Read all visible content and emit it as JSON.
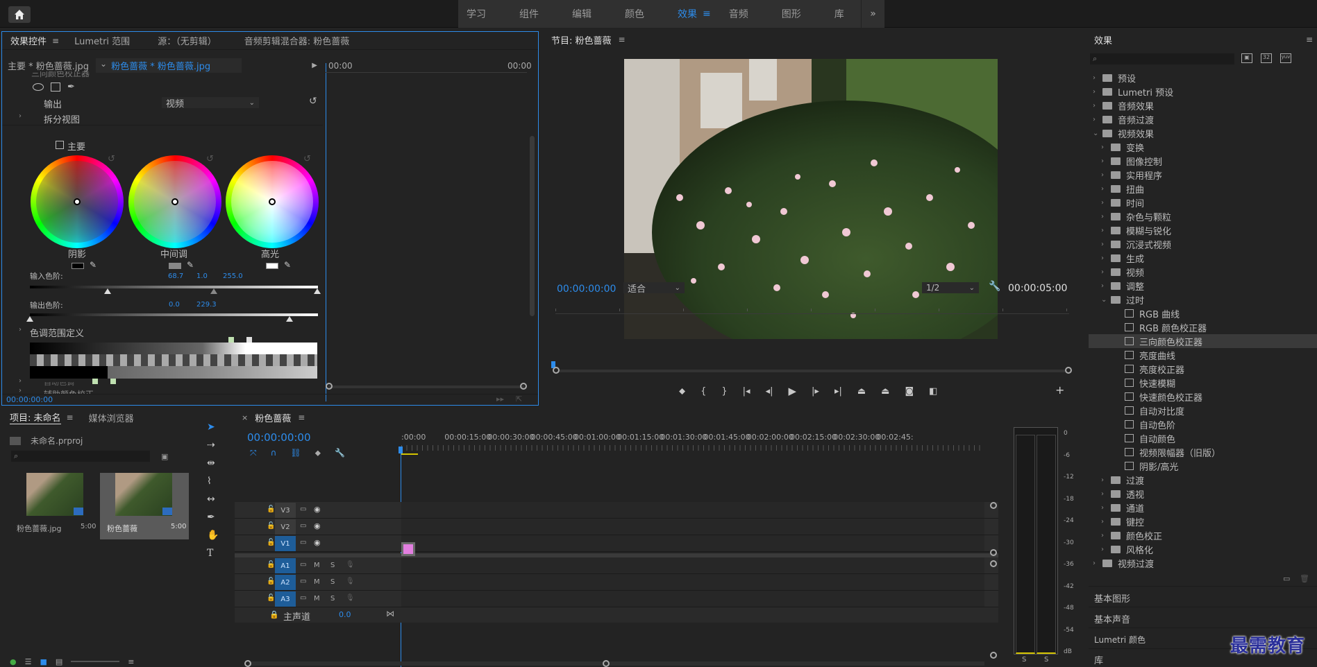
{
  "workspaces": {
    "items": [
      "学习",
      "组件",
      "编辑",
      "颜色",
      "效果",
      "音频",
      "图形",
      "库"
    ],
    "active": "效果",
    "more": "»"
  },
  "effect_controls": {
    "tabs": [
      "效果控件",
      "Lumetri 范围",
      "源：（无剪辑）",
      "音频剪辑混合器: 粉色蔷薇"
    ],
    "master_clip": "主要 * 粉色蔷薇.jpg",
    "sequence_clip": "粉色蔷薇 * 粉色蔷薇.jpg",
    "tc_start": "00:00",
    "tc_end": "00:00",
    "effect_name_partial": "三向颜色校正器",
    "output_label": "输出",
    "output_value": "视频",
    "split_view_label": "拆分视图",
    "master_checkbox": "主要",
    "wheel_labels": [
      "阴影",
      "中间调",
      "高光"
    ],
    "input_levels_label": "输入色阶:",
    "input_levels_values": [
      "68.7",
      "1.0",
      "255.0"
    ],
    "output_levels_label": "输出色阶:",
    "output_levels_values": [
      "0.0",
      "229.3"
    ],
    "tonal_range_label": "色调范围定义",
    "partial_row_1": "自动色调",
    "partial_row_2": "辅助颜色校正",
    "timecode": "00:00:00:00"
  },
  "program": {
    "title": "节目: 粉色蔷薇",
    "timecode": "00:00:00:00",
    "fit": "适合",
    "resolution": "1/2",
    "duration": "00:00:05:00",
    "playhead_fraction": 0.0
  },
  "effects_panel": {
    "title": "效果",
    "items": [
      {
        "label": "预设",
        "level": 0,
        "type": "folder",
        "open": false
      },
      {
        "label": "Lumetri 预设",
        "level": 0,
        "type": "folder",
        "open": false
      },
      {
        "label": "音频效果",
        "level": 0,
        "type": "folder",
        "open": false
      },
      {
        "label": "音频过渡",
        "level": 0,
        "type": "folder",
        "open": false
      },
      {
        "label": "视频效果",
        "level": 0,
        "type": "folder",
        "open": true
      },
      {
        "label": "变换",
        "level": 1,
        "type": "folder",
        "open": false
      },
      {
        "label": "图像控制",
        "level": 1,
        "type": "folder",
        "open": false
      },
      {
        "label": "实用程序",
        "level": 1,
        "type": "folder",
        "open": false
      },
      {
        "label": "扭曲",
        "level": 1,
        "type": "folder",
        "open": false
      },
      {
        "label": "时间",
        "level": 1,
        "type": "folder",
        "open": false
      },
      {
        "label": "杂色与颗粒",
        "level": 1,
        "type": "folder",
        "open": false
      },
      {
        "label": "模糊与锐化",
        "level": 1,
        "type": "folder",
        "open": false
      },
      {
        "label": "沉浸式视频",
        "level": 1,
        "type": "folder",
        "open": false
      },
      {
        "label": "生成",
        "level": 1,
        "type": "folder",
        "open": false
      },
      {
        "label": "视频",
        "level": 1,
        "type": "folder",
        "open": false
      },
      {
        "label": "调整",
        "level": 1,
        "type": "folder",
        "open": false
      },
      {
        "label": "过时",
        "level": 1,
        "type": "folder",
        "open": true
      },
      {
        "label": "RGB 曲线",
        "level": 2,
        "type": "effect"
      },
      {
        "label": "RGB 颜色校正器",
        "level": 2,
        "type": "effect"
      },
      {
        "label": "三向颜色校正器",
        "level": 2,
        "type": "effect",
        "selected": true
      },
      {
        "label": "亮度曲线",
        "level": 2,
        "type": "effect"
      },
      {
        "label": "亮度校正器",
        "level": 2,
        "type": "effect"
      },
      {
        "label": "快速模糊",
        "level": 2,
        "type": "effect"
      },
      {
        "label": "快速颜色校正器",
        "level": 2,
        "type": "effect"
      },
      {
        "label": "自动对比度",
        "level": 2,
        "type": "effect"
      },
      {
        "label": "自动色阶",
        "level": 2,
        "type": "effect"
      },
      {
        "label": "自动颜色",
        "level": 2,
        "type": "effect"
      },
      {
        "label": "视频限幅器（旧版）",
        "level": 2,
        "type": "effect"
      },
      {
        "label": "阴影/高光",
        "level": 2,
        "type": "effect"
      },
      {
        "label": "过渡",
        "level": 1,
        "type": "folder",
        "open": false
      },
      {
        "label": "透视",
        "level": 1,
        "type": "folder",
        "open": false
      },
      {
        "label": "通道",
        "level": 1,
        "type": "folder",
        "open": false
      },
      {
        "label": "键控",
        "level": 1,
        "type": "folder",
        "open": false
      },
      {
        "label": "颜色校正",
        "level": 1,
        "type": "folder",
        "open": false
      },
      {
        "label": "风格化",
        "level": 1,
        "type": "folder",
        "open": false
      },
      {
        "label": "视频过渡",
        "level": 0,
        "type": "folder",
        "open": false
      }
    ],
    "bottom_panels": [
      "基本图形",
      "基本声音",
      "Lumetri 颜色",
      "库"
    ]
  },
  "project": {
    "tabs": [
      "项目: 未命名",
      "媒体浏览器"
    ],
    "filename": "未命名.prproj",
    "items": [
      {
        "name": "粉色蔷薇.jpg",
        "duration": "5:00"
      },
      {
        "name": "粉色蔷薇",
        "duration": "5:00"
      }
    ]
  },
  "timeline": {
    "tab": "粉色蔷薇",
    "timecode": "00:00:00:00",
    "ruler": [
      ":00:00",
      "00:00:15:00",
      "00:00:30:00",
      "00:00:45:00",
      "00:01:00:00",
      "00:01:15:00",
      "00:01:30:00",
      "00:01:45:00",
      "00:02:00:00",
      "00:02:15:00",
      "00:02:30:00",
      "00:02:45:"
    ],
    "video_tracks": [
      "V3",
      "V2",
      "V1"
    ],
    "audio_tracks": [
      "A1",
      "A2",
      "A3"
    ],
    "master_label": "主声道",
    "master_value": "0.0",
    "mute": "M",
    "solo": "S"
  },
  "meter": {
    "scale": [
      "0",
      "-6",
      "-12",
      "-18",
      "-24",
      "-30",
      "-36",
      "-42",
      "-48",
      "-54",
      "dB"
    ],
    "solo": [
      "S",
      "S"
    ]
  },
  "watermark": "最需教育",
  "colors": {
    "accent": "#2d8ceb",
    "panel": "#232323",
    "clip": "#e27fe0"
  }
}
